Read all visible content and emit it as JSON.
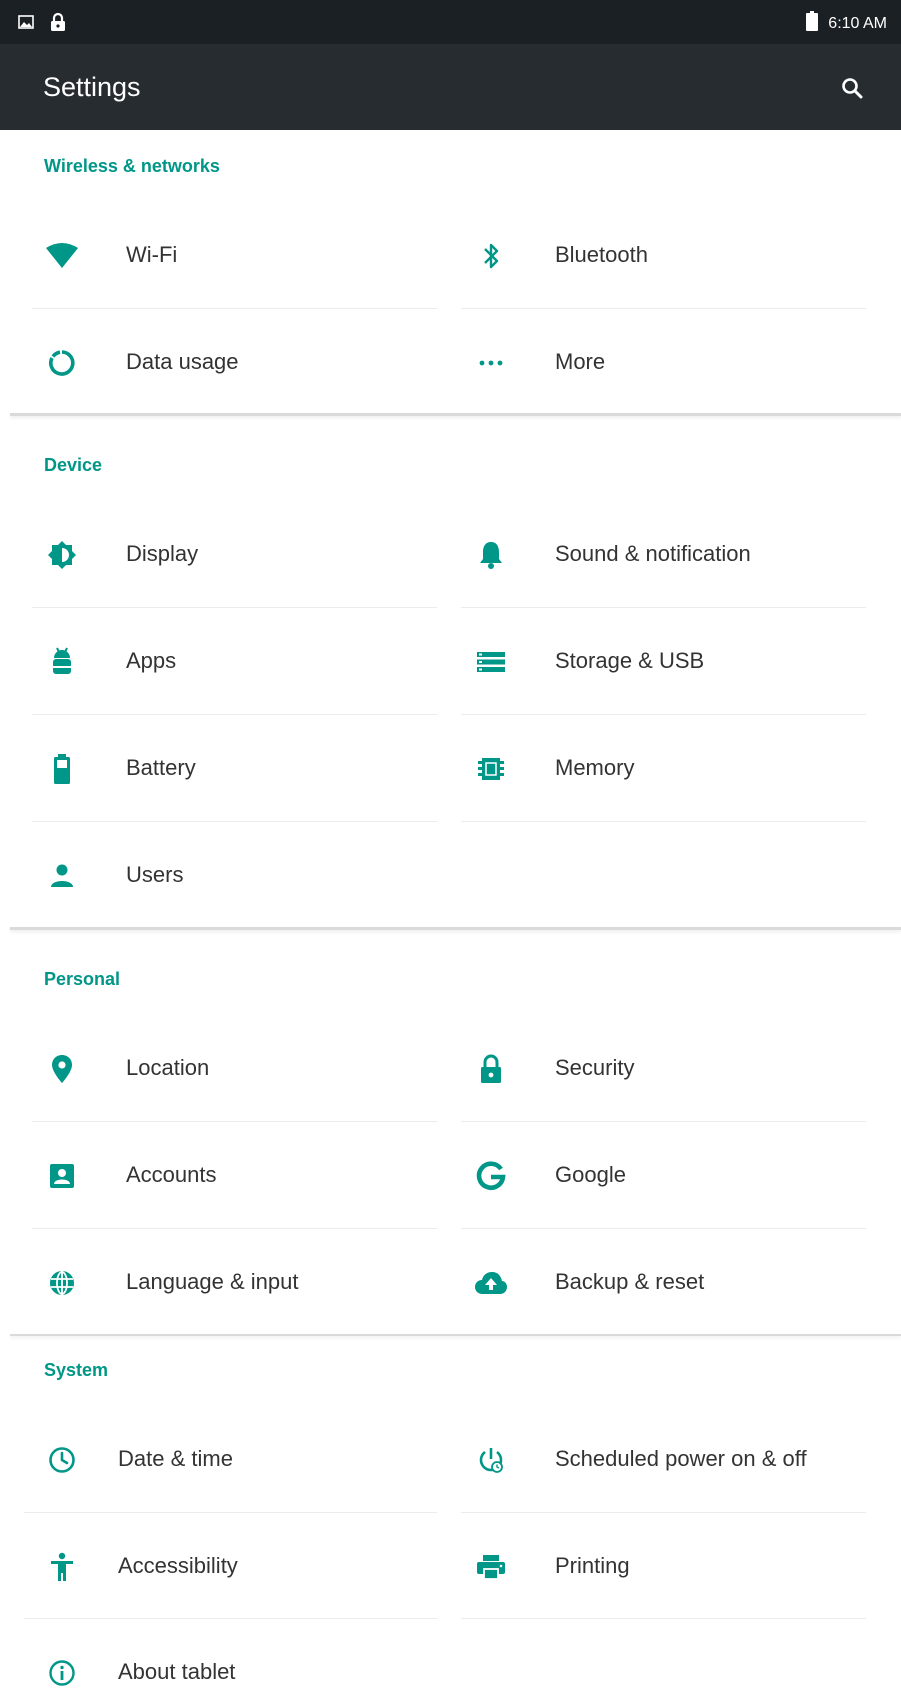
{
  "status_bar": {
    "time": "6:10 AM",
    "icons": [
      "image-notification-icon",
      "lock-notification-icon",
      "battery-icon"
    ]
  },
  "app_bar": {
    "title": "Settings",
    "search_icon": "search-icon"
  },
  "colors": {
    "accent": "#009688",
    "status_bar": "#1b2025",
    "app_bar": "#272c31"
  },
  "sections": [
    {
      "header": "Wireless & networks",
      "items": [
        {
          "label": "Wi-Fi",
          "icon": "wifi-icon"
        },
        {
          "label": "Bluetooth",
          "icon": "bluetooth-icon"
        },
        {
          "label": "Data usage",
          "icon": "data-usage-icon"
        },
        {
          "label": "More",
          "icon": "more-icon"
        }
      ]
    },
    {
      "header": "Device",
      "items": [
        {
          "label": "Display",
          "icon": "display-icon"
        },
        {
          "label": "Sound & notification",
          "icon": "bell-icon"
        },
        {
          "label": "Apps",
          "icon": "android-icon"
        },
        {
          "label": "Storage & USB",
          "icon": "storage-icon"
        },
        {
          "label": "Battery",
          "icon": "battery-icon"
        },
        {
          "label": "Memory",
          "icon": "memory-icon"
        },
        {
          "label": "Users",
          "icon": "user-icon"
        }
      ]
    },
    {
      "header": "Personal",
      "items": [
        {
          "label": "Location",
          "icon": "location-icon"
        },
        {
          "label": "Security",
          "icon": "lock-icon"
        },
        {
          "label": "Accounts",
          "icon": "account-icon"
        },
        {
          "label": "Google",
          "icon": "google-icon"
        },
        {
          "label": "Language & input",
          "icon": "globe-icon"
        },
        {
          "label": "Backup & reset",
          "icon": "cloud-upload-icon"
        }
      ]
    },
    {
      "header": "System",
      "items": [
        {
          "label": "Date & time",
          "icon": "clock-icon"
        },
        {
          "label": "Scheduled power on & off",
          "icon": "power-schedule-icon"
        },
        {
          "label": "Accessibility",
          "icon": "accessibility-icon"
        },
        {
          "label": "Printing",
          "icon": "printer-icon"
        },
        {
          "label": "About tablet",
          "icon": "info-icon"
        }
      ]
    }
  ]
}
